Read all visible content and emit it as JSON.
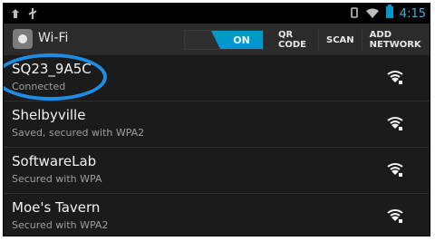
{
  "status_bar": {
    "time": "4:15",
    "icons": [
      "usb-debug-icon",
      "usb-icon",
      "vibrate-icon",
      "wifi-signal-icon",
      "battery-icon"
    ]
  },
  "action_bar": {
    "title": "Wi-Fi",
    "toggle_label": "ON",
    "actions": [
      "QR CODE",
      "SCAN",
      "ADD NETWORK"
    ]
  },
  "networks": [
    {
      "ssid": "SQ23_9A5C",
      "status": "Connected"
    },
    {
      "ssid": "Shelbyville",
      "status": "Saved, secured with WPA2"
    },
    {
      "ssid": "SoftwareLab",
      "status": "Secured with WPA"
    },
    {
      "ssid": "Moe's Tavern",
      "status": "Secured with WPA2"
    }
  ],
  "colors": {
    "accent": "#0099cc",
    "highlight": "#1f8de6"
  }
}
